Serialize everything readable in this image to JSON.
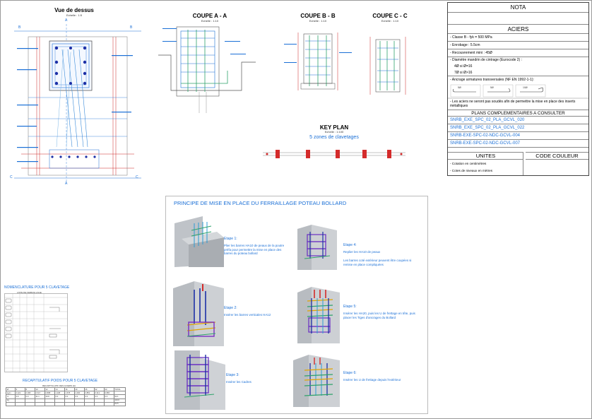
{
  "views": {
    "top": {
      "title": "Vue de dessus",
      "scale": "Echelle : 1:5",
      "mark_a": "A",
      "mark_b": "B",
      "mark_c": "C"
    },
    "coupe_aa": {
      "title": "COUPE A - A",
      "scale": "Echelle : 1:10"
    },
    "coupe_bb": {
      "title": "COUPE B - B",
      "scale": "Echelle : 1:10"
    },
    "coupe_cc": {
      "title": "COUPE C - C",
      "scale": "Echelle : 1:10"
    },
    "key_plan": {
      "title": "KEY PLAN",
      "scale": "Echelle : 1:100",
      "subtitle": "5 zones de clavetages"
    }
  },
  "nota": {
    "title": "NOTA",
    "aciers_title": "ACIERS",
    "aciers_lines": [
      "- Classe B - fyk = 500 MPa",
      "- Enrobage : 5.5cm",
      "- Recouvrement mini : 45Ø",
      "- Diamètre mandrin de cintrage (Eurocode 2) :",
      "4Ø si Ø=16",
      "7Ø si Ø>16",
      "- Ancrage armatures transversales (NF EN 1992-1-1):"
    ],
    "hook_labels": [
      "5Ø",
      "5Ø",
      "10Ø"
    ],
    "note": "- Les aciers ne seront pas soudés afin de permettre la mise en place des inserts métalliques",
    "plans_title": "PLANS COMPLEMENTAIRES A CONSULTER",
    "plans": [
      "SNRB_EXE_SPC_02_PLA_GCVL_020",
      "SNRB_EXE_SPC_02_PLA_GCVL_022",
      "SNRB-EXE-SPC-02-NDC-GCVL-004",
      "SNRB-EXE-SPC-02-NDC-GCVL-007"
    ],
    "unites_title": "UNITES",
    "code_couleur_title": "CODE COULEUR",
    "unites_lines": [
      "- Cotation en centimètres",
      "- Cotes de niveaux en mètres"
    ]
  },
  "principe": {
    "title": "PRINCIPE DE MISE EN PLACE DU FERRAILLAGE POTEAU BOLLARD",
    "steps": [
      {
        "label": "Etape 1:",
        "text": "Plier les barres HA10 de peaux de la poutre préfa pour permettre la mise en place des barres du poteau bollard"
      },
      {
        "label": "Etape 2:",
        "text": "Insérer les barres verticales HA12"
      },
      {
        "label": "Etape 3:",
        "text": "Insérer les Cadres"
      },
      {
        "label": "Etape 4:",
        "text": "Replier les HA10 de peaux",
        "text2": "Les barres coté extérieur peuvent être coupées si remise en place compliquées"
      },
      {
        "label": "Etape 5:",
        "text": "Insérer les HA20, puis les U de frettage en tête, puis placer les Tiges d'ancrages du Bollard"
      },
      {
        "label": "Etape 6:",
        "text": "Insérer les U de frettage depuis l'extérieur"
      }
    ]
  },
  "nomenclature": {
    "title": "NOMENCLATURE POUR 5 CLAVETAGE",
    "table_title": "LISTE DE FERRAILLAGE"
  },
  "recap": {
    "title": "RECAPITULATIF POIDS POUR 5 CLAVETAGE",
    "table_title": "RECAPITULATIF DES ACIERS HA",
    "total_label": "TOTAL",
    "row1": [
      "0.222",
      "0.395",
      "0.617",
      "0.888",
      "1.208",
      "1.578",
      "2.466",
      "3.853",
      "6.313",
      "9.865"
    ],
    "row2": [
      "0.0",
      "0.0",
      "41.1",
      "20.8",
      "0.0",
      "0.0",
      "0.0",
      "0.0",
      "0.0",
      "0.0"
    ],
    "totals": [
      "52.1",
      "113.0",
      "52.5"
    ]
  },
  "colors": {
    "accent": "#1a6fd6",
    "rebar": "#1a6fd6",
    "red": "#cc2222",
    "grey": "#9a9a9a"
  }
}
